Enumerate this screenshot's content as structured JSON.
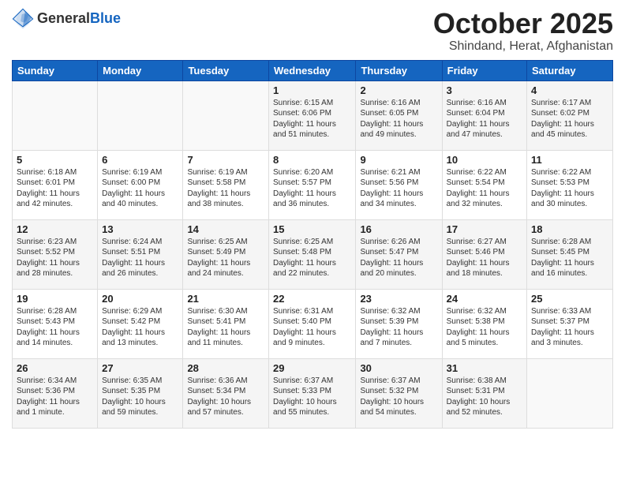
{
  "header": {
    "logo_line1": "General",
    "logo_line2": "Blue",
    "month": "October 2025",
    "location": "Shindand, Herat, Afghanistan"
  },
  "weekdays": [
    "Sunday",
    "Monday",
    "Tuesday",
    "Wednesday",
    "Thursday",
    "Friday",
    "Saturday"
  ],
  "weeks": [
    [
      {
        "day": "",
        "info": ""
      },
      {
        "day": "",
        "info": ""
      },
      {
        "day": "",
        "info": ""
      },
      {
        "day": "1",
        "info": "Sunrise: 6:15 AM\nSunset: 6:06 PM\nDaylight: 11 hours\nand 51 minutes."
      },
      {
        "day": "2",
        "info": "Sunrise: 6:16 AM\nSunset: 6:05 PM\nDaylight: 11 hours\nand 49 minutes."
      },
      {
        "day": "3",
        "info": "Sunrise: 6:16 AM\nSunset: 6:04 PM\nDaylight: 11 hours\nand 47 minutes."
      },
      {
        "day": "4",
        "info": "Sunrise: 6:17 AM\nSunset: 6:02 PM\nDaylight: 11 hours\nand 45 minutes."
      }
    ],
    [
      {
        "day": "5",
        "info": "Sunrise: 6:18 AM\nSunset: 6:01 PM\nDaylight: 11 hours\nand 42 minutes."
      },
      {
        "day": "6",
        "info": "Sunrise: 6:19 AM\nSunset: 6:00 PM\nDaylight: 11 hours\nand 40 minutes."
      },
      {
        "day": "7",
        "info": "Sunrise: 6:19 AM\nSunset: 5:58 PM\nDaylight: 11 hours\nand 38 minutes."
      },
      {
        "day": "8",
        "info": "Sunrise: 6:20 AM\nSunset: 5:57 PM\nDaylight: 11 hours\nand 36 minutes."
      },
      {
        "day": "9",
        "info": "Sunrise: 6:21 AM\nSunset: 5:56 PM\nDaylight: 11 hours\nand 34 minutes."
      },
      {
        "day": "10",
        "info": "Sunrise: 6:22 AM\nSunset: 5:54 PM\nDaylight: 11 hours\nand 32 minutes."
      },
      {
        "day": "11",
        "info": "Sunrise: 6:22 AM\nSunset: 5:53 PM\nDaylight: 11 hours\nand 30 minutes."
      }
    ],
    [
      {
        "day": "12",
        "info": "Sunrise: 6:23 AM\nSunset: 5:52 PM\nDaylight: 11 hours\nand 28 minutes."
      },
      {
        "day": "13",
        "info": "Sunrise: 6:24 AM\nSunset: 5:51 PM\nDaylight: 11 hours\nand 26 minutes."
      },
      {
        "day": "14",
        "info": "Sunrise: 6:25 AM\nSunset: 5:49 PM\nDaylight: 11 hours\nand 24 minutes."
      },
      {
        "day": "15",
        "info": "Sunrise: 6:25 AM\nSunset: 5:48 PM\nDaylight: 11 hours\nand 22 minutes."
      },
      {
        "day": "16",
        "info": "Sunrise: 6:26 AM\nSunset: 5:47 PM\nDaylight: 11 hours\nand 20 minutes."
      },
      {
        "day": "17",
        "info": "Sunrise: 6:27 AM\nSunset: 5:46 PM\nDaylight: 11 hours\nand 18 minutes."
      },
      {
        "day": "18",
        "info": "Sunrise: 6:28 AM\nSunset: 5:45 PM\nDaylight: 11 hours\nand 16 minutes."
      }
    ],
    [
      {
        "day": "19",
        "info": "Sunrise: 6:28 AM\nSunset: 5:43 PM\nDaylight: 11 hours\nand 14 minutes."
      },
      {
        "day": "20",
        "info": "Sunrise: 6:29 AM\nSunset: 5:42 PM\nDaylight: 11 hours\nand 13 minutes."
      },
      {
        "day": "21",
        "info": "Sunrise: 6:30 AM\nSunset: 5:41 PM\nDaylight: 11 hours\nand 11 minutes."
      },
      {
        "day": "22",
        "info": "Sunrise: 6:31 AM\nSunset: 5:40 PM\nDaylight: 11 hours\nand 9 minutes."
      },
      {
        "day": "23",
        "info": "Sunrise: 6:32 AM\nSunset: 5:39 PM\nDaylight: 11 hours\nand 7 minutes."
      },
      {
        "day": "24",
        "info": "Sunrise: 6:32 AM\nSunset: 5:38 PM\nDaylight: 11 hours\nand 5 minutes."
      },
      {
        "day": "25",
        "info": "Sunrise: 6:33 AM\nSunset: 5:37 PM\nDaylight: 11 hours\nand 3 minutes."
      }
    ],
    [
      {
        "day": "26",
        "info": "Sunrise: 6:34 AM\nSunset: 5:36 PM\nDaylight: 11 hours\nand 1 minute."
      },
      {
        "day": "27",
        "info": "Sunrise: 6:35 AM\nSunset: 5:35 PM\nDaylight: 10 hours\nand 59 minutes."
      },
      {
        "day": "28",
        "info": "Sunrise: 6:36 AM\nSunset: 5:34 PM\nDaylight: 10 hours\nand 57 minutes."
      },
      {
        "day": "29",
        "info": "Sunrise: 6:37 AM\nSunset: 5:33 PM\nDaylight: 10 hours\nand 55 minutes."
      },
      {
        "day": "30",
        "info": "Sunrise: 6:37 AM\nSunset: 5:32 PM\nDaylight: 10 hours\nand 54 minutes."
      },
      {
        "day": "31",
        "info": "Sunrise: 6:38 AM\nSunset: 5:31 PM\nDaylight: 10 hours\nand 52 minutes."
      },
      {
        "day": "",
        "info": ""
      }
    ]
  ]
}
